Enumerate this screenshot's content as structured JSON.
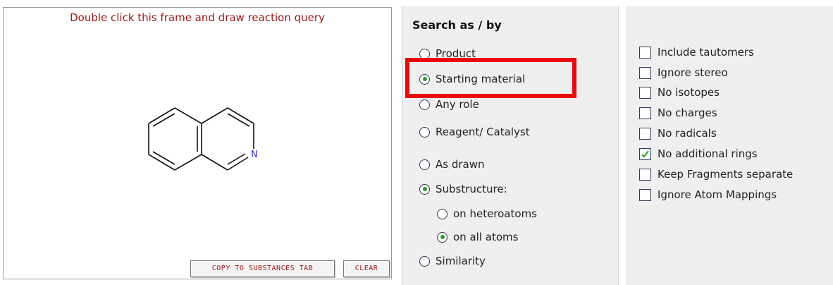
{
  "draw_frame": {
    "prompt": "Double click this frame and draw reaction query",
    "molecule": {
      "name": "isoquinoline",
      "atom_label": "N"
    },
    "buttons": {
      "copy": "COPY TO SUBSTANCES TAB",
      "clear": "CLEAR"
    }
  },
  "search": {
    "heading": "Search as / by",
    "role_options": [
      {
        "label": "Product",
        "selected": false
      },
      {
        "label": "Starting material",
        "selected": true
      },
      {
        "label": "Any role",
        "selected": false
      },
      {
        "label": "Reagent/ Catalyst",
        "selected": false
      }
    ],
    "mode_options": [
      {
        "label": "As drawn",
        "selected": false
      },
      {
        "label": "Substructure:",
        "selected": true
      },
      {
        "label": "on heteroatoms",
        "selected": false
      },
      {
        "label": "on all atoms",
        "selected": true
      },
      {
        "label": "Similarity",
        "selected": false
      }
    ]
  },
  "options": [
    {
      "label": "Include tautomers",
      "checked": false
    },
    {
      "label": "Ignore stereo",
      "checked": false
    },
    {
      "label": "No isotopes",
      "checked": false
    },
    {
      "label": "No charges",
      "checked": false
    },
    {
      "label": "No radicals",
      "checked": false
    },
    {
      "label": "No additional rings",
      "checked": true
    },
    {
      "label": "Keep Fragments separate",
      "checked": false
    },
    {
      "label": "Ignore Atom Mappings",
      "checked": false
    }
  ],
  "colors": {
    "highlight": "#e8090f",
    "prompt": "#a01818",
    "radio_dot": "#2b9a2b",
    "check_mark": "#2b9a2b"
  }
}
